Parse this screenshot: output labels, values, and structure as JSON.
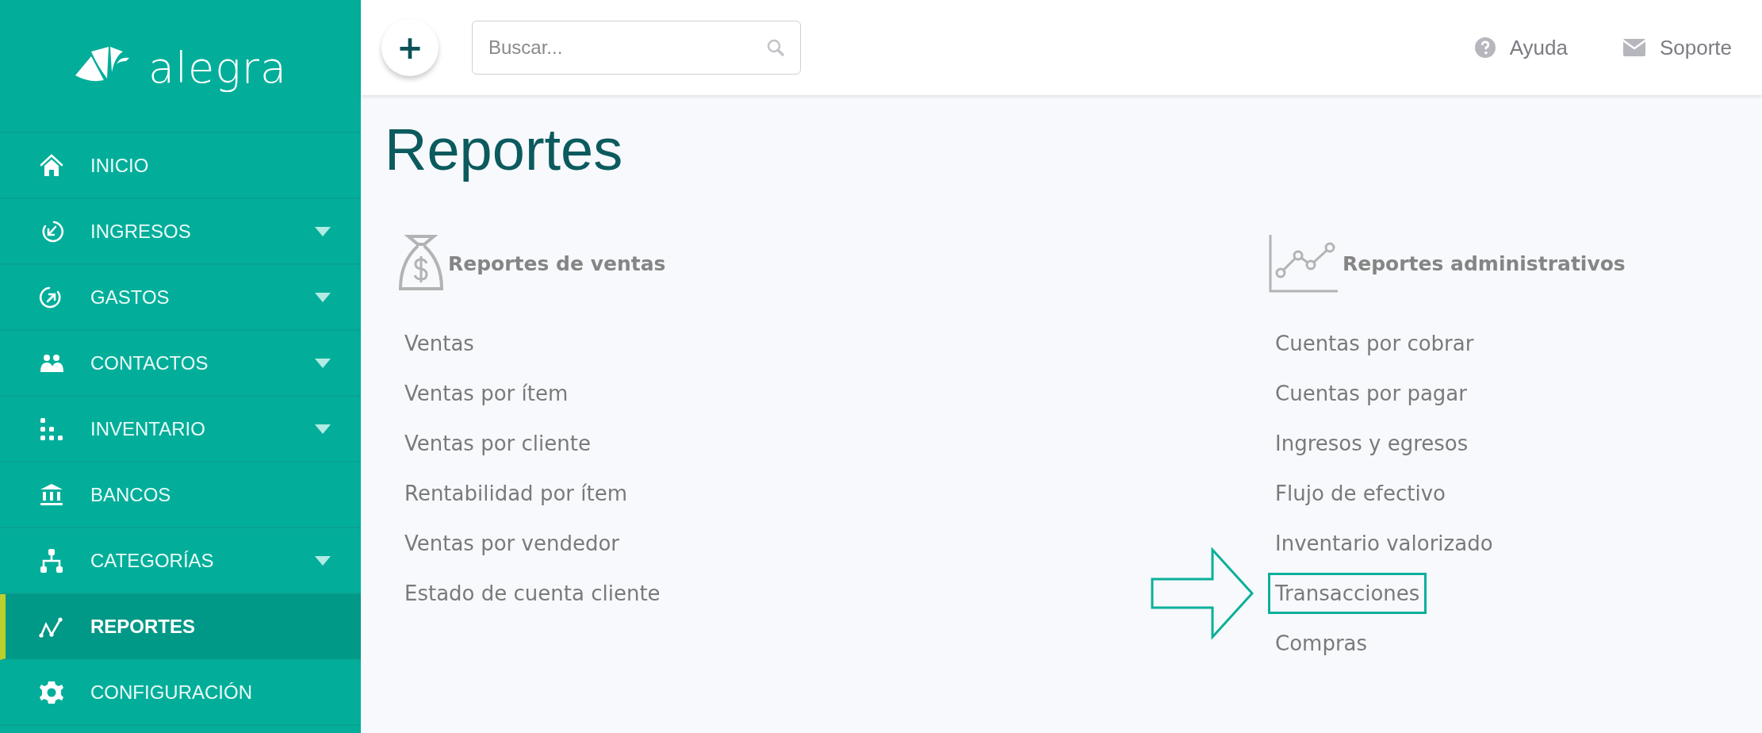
{
  "sidebar": {
    "logo": "alegra",
    "items": [
      {
        "label": "INICIO",
        "kind": "home",
        "selected": false
      },
      {
        "label": "INGRESOS",
        "kind": "income",
        "selected": false,
        "expanded": false
      },
      {
        "label": "GASTOS",
        "kind": "expense",
        "selected": false,
        "expanded": false
      },
      {
        "label": "CONTACTOS",
        "kind": "people",
        "selected": false,
        "expanded": false
      },
      {
        "label": "INVENTARIO",
        "kind": "stock",
        "selected": false,
        "expanded": false
      },
      {
        "label": "BANCOS",
        "kind": "bank",
        "selected": false
      },
      {
        "label": "CATEGORÍAS",
        "kind": "tree",
        "selected": false,
        "expanded": false
      },
      {
        "label": "REPORTES",
        "kind": "chart",
        "selected": true
      },
      {
        "label": "CONFIGURACIÓN",
        "kind": "gear",
        "selected": false
      }
    ]
  },
  "topbar": {
    "add_button": "+",
    "search": {
      "placeholder": "Buscar..."
    },
    "links": [
      {
        "label": "Ayuda",
        "kind": "help"
      },
      {
        "label": "Soporte",
        "kind": "mail"
      }
    ]
  },
  "page": {
    "title": "Reportes",
    "sections": [
      {
        "title": "Reportes de ventas",
        "kind": "money",
        "items": [
          {
            "label": "Ventas",
            "highlighted": false
          },
          {
            "label": "Ventas por ítem",
            "highlighted": false
          },
          {
            "label": "Ventas por cliente",
            "highlighted": false
          },
          {
            "label": "Rentabilidad por ítem",
            "highlighted": false
          },
          {
            "label": "Ventas por vendedor",
            "highlighted": false
          },
          {
            "label": "Estado de cuenta cliente",
            "highlighted": false
          }
        ]
      },
      {
        "title": "Reportes administrativos",
        "kind": "graph",
        "items": [
          {
            "label": "Cuentas por cobrar",
            "highlighted": false
          },
          {
            "label": "Cuentas por pagar",
            "highlighted": false
          },
          {
            "label": "Ingresos y egresos",
            "highlighted": false
          },
          {
            "label": "Flujo de efectivo",
            "highlighted": false
          },
          {
            "label": "Inventario valorizado",
            "highlighted": false
          },
          {
            "label": "Transacciones",
            "highlighted": true
          },
          {
            "label": "Compras",
            "highlighted": false
          }
        ]
      }
    ]
  }
}
